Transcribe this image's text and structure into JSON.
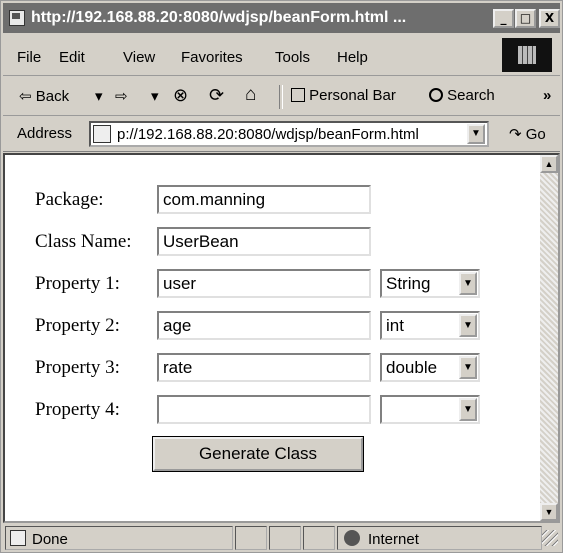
{
  "window": {
    "title": "http://192.168.88.20:8080/wdjsp/beanForm.html ...",
    "min_glyph": "_",
    "max_glyph": "□",
    "close_glyph": "X"
  },
  "menu": {
    "items": [
      "File",
      "Edit",
      "View",
      "Favorites",
      "Tools",
      "Help"
    ]
  },
  "toolbar": {
    "back_label": "Back",
    "back_glyph": "⇦",
    "forward_glyph": "⇨",
    "dropdown_glyph": "▾",
    "stop_glyph": "⊗",
    "refresh_glyph": "⟳",
    "home_glyph": "⌂",
    "personal_bar_label": "Personal Bar",
    "search_label": "Search",
    "more_glyph": "»"
  },
  "address": {
    "label": "Address",
    "url": "p://192.168.88.20:8080/wdjsp/beanForm.html",
    "go_label": "Go",
    "go_glyph": "↷"
  },
  "form": {
    "package_label": "Package:",
    "package_value": "com.manning",
    "class_name_label": "Class Name:",
    "class_name_value": "UserBean",
    "properties": [
      {
        "label": "Property 1:",
        "name": "user",
        "type": "String"
      },
      {
        "label": "Property 2:",
        "name": "age",
        "type": "int"
      },
      {
        "label": "Property 3:",
        "name": "rate",
        "type": "double"
      },
      {
        "label": "Property 4:",
        "name": "",
        "type": ""
      }
    ],
    "select_arrow": "▼",
    "generate_button": "Generate Class"
  },
  "scrollbar": {
    "up_glyph": "▲",
    "down_glyph": "▼"
  },
  "status": {
    "done_label": "Done",
    "zone_label": "Internet"
  }
}
